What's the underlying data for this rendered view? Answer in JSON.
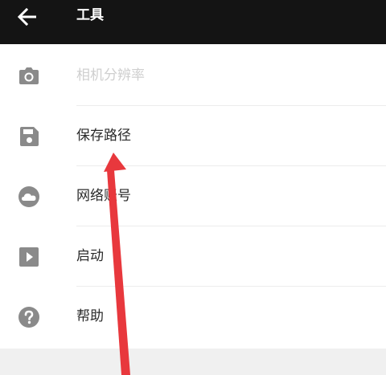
{
  "toolbar": {
    "title": "工具",
    "back_icon": "arrow-left-icon"
  },
  "items": [
    {
      "label": "相机分辨率",
      "icon": "camera-icon",
      "enabled": false
    },
    {
      "label": "保存路径",
      "icon": "save-icon",
      "enabled": true
    },
    {
      "label": "网络账号",
      "icon": "cloud-icon",
      "enabled": true
    },
    {
      "label": "启动",
      "icon": "play-icon",
      "enabled": true
    },
    {
      "label": "帮助",
      "icon": "help-icon",
      "enabled": true
    }
  ],
  "colors": {
    "toolbar_bg": "#141414",
    "icon": "#8a8a8a",
    "annotation_arrow": "#e8383d"
  }
}
